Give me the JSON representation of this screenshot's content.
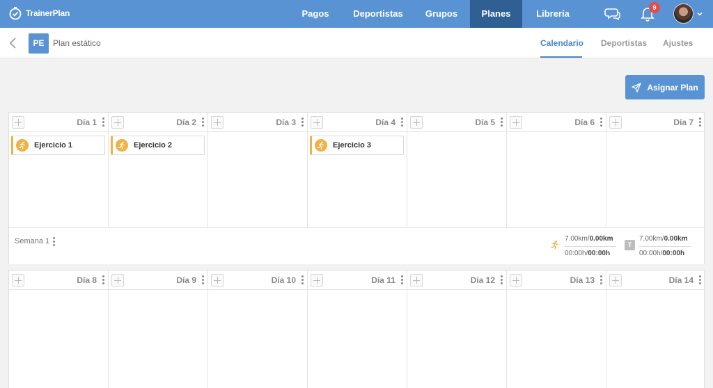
{
  "app": {
    "name": "TrainerPlan"
  },
  "nav": {
    "items": [
      {
        "label": "Pagos",
        "active": false
      },
      {
        "label": "Deportistas",
        "active": false
      },
      {
        "label": "Grupos",
        "active": false
      },
      {
        "label": "Planes",
        "active": true
      },
      {
        "label": "Librería",
        "active": false
      }
    ],
    "notifications_count": "9"
  },
  "plan": {
    "badge": "PE",
    "title": "Plan estático"
  },
  "tabs": [
    {
      "label": "Calendario",
      "active": true
    },
    {
      "label": "Deportistas",
      "active": false
    },
    {
      "label": "Ajustes",
      "active": false
    }
  ],
  "assign_button": {
    "label": "Asignar Plan"
  },
  "weeks": [
    {
      "days": [
        {
          "label": "Día 1",
          "workout": "Ejercicio 1"
        },
        {
          "label": "Día 2",
          "workout": "Ejercicio 2"
        },
        {
          "label": "Día 3",
          "workout": ""
        },
        {
          "label": "Día 4",
          "workout": "Ejercicio 3"
        },
        {
          "label": "Día 5",
          "workout": ""
        },
        {
          "label": "Día 6",
          "workout": ""
        },
        {
          "label": "Día 7",
          "workout": ""
        }
      ],
      "summary": {
        "label": "Semana 1",
        "run": {
          "distance_planned": "7.00km/",
          "distance_done": "0.00km",
          "time_planned": "00:00h/",
          "time_done": "00:00h"
        },
        "total": {
          "icon_letter": "T",
          "distance_planned": "7.00km/",
          "distance_done": "0.00km",
          "time_planned": "00:00h/",
          "time_done": "00:00h"
        }
      }
    },
    {
      "days": [
        {
          "label": "Día 8"
        },
        {
          "label": "Día 9"
        },
        {
          "label": "Día 10"
        },
        {
          "label": "Día 11"
        },
        {
          "label": "Día 12"
        },
        {
          "label": "Día 13"
        },
        {
          "label": "Día 14"
        }
      ]
    }
  ],
  "colors": {
    "primary": "#5a93d3",
    "nav_active": "#2f5f93",
    "workout_accent": "#f0b246",
    "badge": "#e84b4b"
  }
}
